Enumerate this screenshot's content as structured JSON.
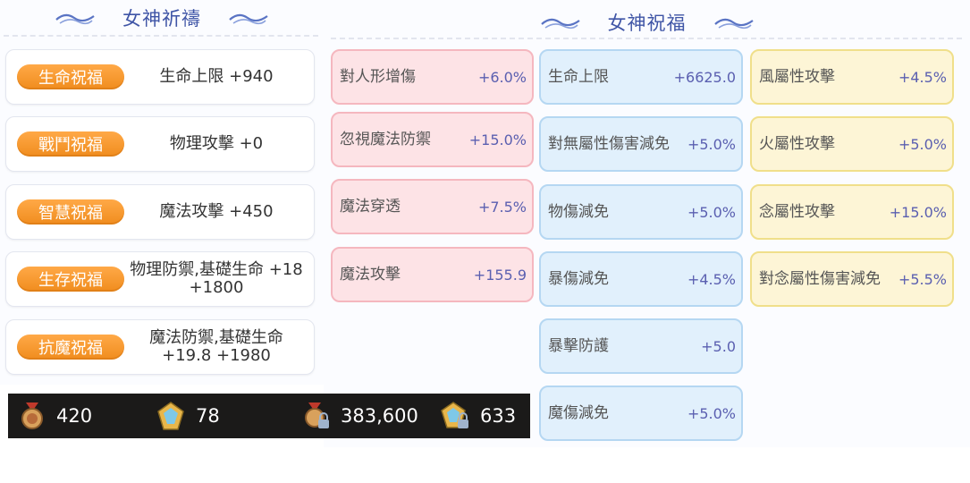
{
  "left_panel": {
    "title": "女神祈禱",
    "blessings": [
      {
        "label": "生命祝福",
        "value": "生命上限 +940"
      },
      {
        "label": "戰鬥祝福",
        "value": "物理攻擊 +0"
      },
      {
        "label": "智慧祝福",
        "value": "魔法攻擊 +450"
      },
      {
        "label": "生存祝福",
        "value": "物理防禦,基礎生命 +18 +1800"
      },
      {
        "label": "抗魔祝福",
        "value": "魔法防禦,基礎生命 +19.8 +1980"
      }
    ]
  },
  "right_panel": {
    "title": "女神祝福",
    "columns": [
      [
        {
          "name": "對人形增傷",
          "value": "+6.0%"
        },
        {
          "name": "忽視魔法防禦",
          "value": "+15.0%"
        },
        {
          "name": "魔法穿透",
          "value": "+7.5%"
        },
        {
          "name": "魔法攻擊",
          "value": "+155.9"
        }
      ],
      [
        {
          "name": "生命上限",
          "value": "+6625.0"
        },
        {
          "name": "對無屬性傷害減免",
          "value": "+5.0%"
        },
        {
          "name": "物傷減免",
          "value": "+5.0%"
        },
        {
          "name": "暴傷減免",
          "value": "+4.5%"
        },
        {
          "name": "暴擊防護",
          "value": "+5.0"
        },
        {
          "name": "魔傷減免",
          "value": "+5.0%"
        }
      ],
      [
        {
          "name": "風屬性攻擊",
          "value": "+4.5%"
        },
        {
          "name": "火屬性攻擊",
          "value": "+5.0%"
        },
        {
          "name": "念屬性攻擊",
          "value": "+15.0%"
        },
        {
          "name": "對念屬性傷害減免",
          "value": "+5.5%"
        }
      ]
    ]
  },
  "resources": [
    {
      "icon": "medal-icon",
      "value": "420"
    },
    {
      "icon": "crystal-icon",
      "value": "78"
    },
    {
      "icon": "locked-medal-icon",
      "value": "383,600"
    },
    {
      "icon": "locked-crystal-icon",
      "value": "633"
    }
  ],
  "colors": {
    "title": "#3f55a6",
    "badge": "#f39a2e",
    "pink_card": "#fde3e6",
    "blue_card": "#e1f0fc",
    "yellow_card": "#fdf5d6",
    "value_text": "#5a5fb0"
  }
}
